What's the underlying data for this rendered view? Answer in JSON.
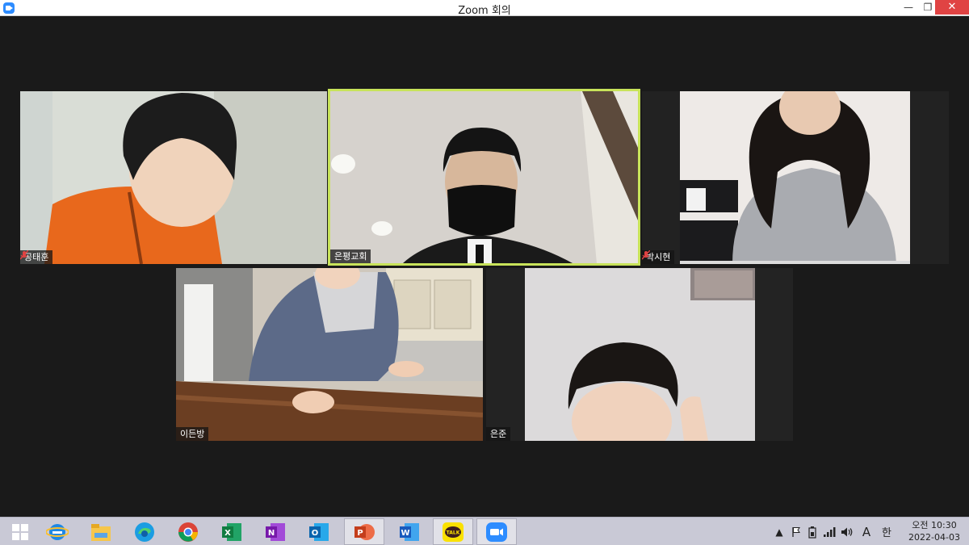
{
  "window": {
    "title": "Zoom 회의",
    "min_glyph": "—",
    "max_glyph": "❐",
    "close_glyph": "✕"
  },
  "participants": [
    {
      "name": "공태훈",
      "muted": true
    },
    {
      "name": "은평교회",
      "muted": false,
      "active_speaker": true
    },
    {
      "name": "박시현",
      "muted": true
    },
    {
      "name": "이든방",
      "muted": false
    },
    {
      "name": "은준",
      "muted": false
    }
  ],
  "taskbar": {
    "apps": [
      {
        "icon": "windows-start-icon"
      },
      {
        "icon": "internet-explorer-icon"
      },
      {
        "icon": "file-explorer-icon"
      },
      {
        "icon": "edge-icon"
      },
      {
        "icon": "chrome-icon"
      },
      {
        "icon": "excel-icon",
        "letter": "X"
      },
      {
        "icon": "onenote-icon",
        "letter": "N"
      },
      {
        "icon": "outlook-icon",
        "letter": "O"
      },
      {
        "icon": "powerpoint-icon",
        "letter": "P"
      },
      {
        "icon": "word-icon",
        "letter": "W"
      },
      {
        "icon": "kakaotalk-icon",
        "letter": "TALK"
      },
      {
        "icon": "zoom-icon"
      }
    ],
    "tray": {
      "ime_label": "A",
      "hangul_label": "한",
      "time": "오전 10:30",
      "date": "2022-04-03"
    }
  },
  "colors": {
    "active_speaker_border": "#c8e35a",
    "close_button": "#e04343",
    "zoom_blue": "#2d8cff"
  }
}
